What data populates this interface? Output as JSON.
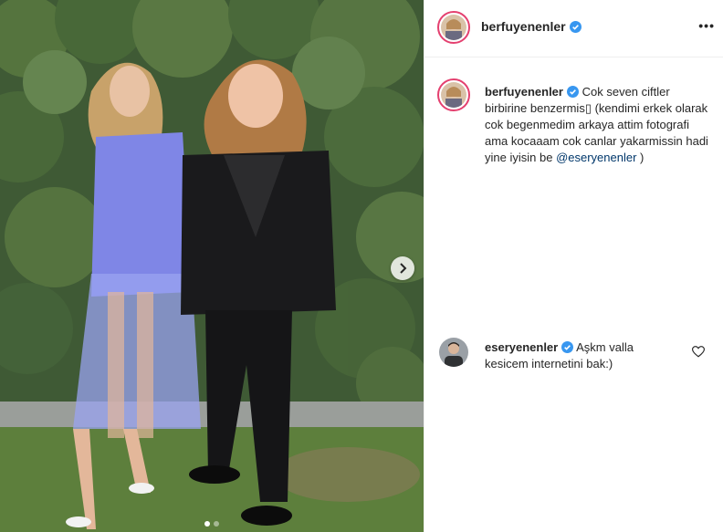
{
  "post": {
    "author": "berfuyenenler",
    "caption_text": "Cok seven ciftler birbirine benzermis▯ (kendimi erkek olarak cok begenmedim arkaya attim fotografi ama kocaaam cok canlar yakarmissin hadi yine iyisin be",
    "caption_mention": "@eseryenenler",
    "caption_end": " )",
    "more_label": "•••"
  },
  "comments": [
    {
      "author": "eseryenenler",
      "text": "Aşkm valla kesicem internetini bak:)"
    }
  ],
  "carousel": {
    "slides": 2,
    "current": 1
  },
  "colors": {
    "verified": "#3897f0",
    "ring": "#e4406f",
    "mention": "#00376b"
  },
  "icons": {
    "verified": "verified-badge-icon",
    "like": "heart-outline-icon",
    "next": "chevron-right-icon",
    "more": "more-options-icon"
  }
}
